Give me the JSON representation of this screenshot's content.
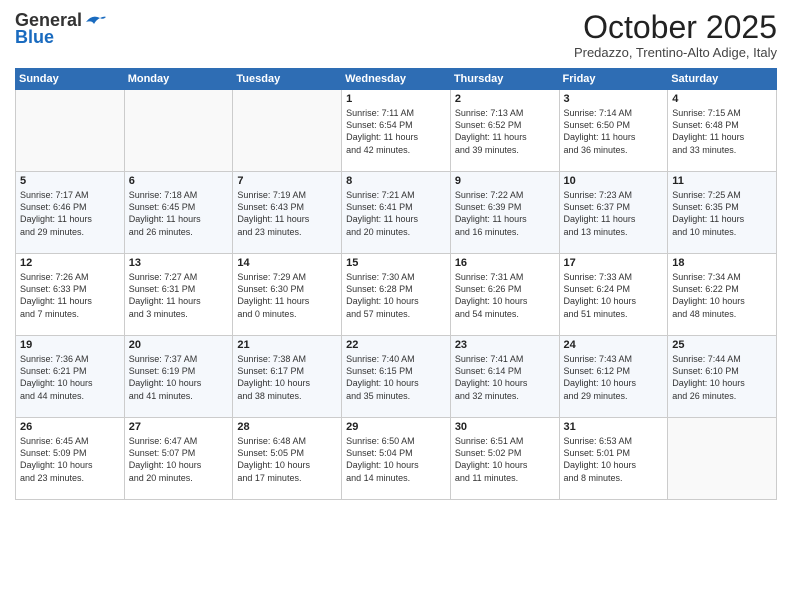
{
  "header": {
    "logo_general": "General",
    "logo_blue": "Blue",
    "month": "October 2025",
    "location": "Predazzo, Trentino-Alto Adige, Italy"
  },
  "days_of_week": [
    "Sunday",
    "Monday",
    "Tuesday",
    "Wednesday",
    "Thursday",
    "Friday",
    "Saturday"
  ],
  "weeks": [
    [
      {
        "day": "",
        "info": ""
      },
      {
        "day": "",
        "info": ""
      },
      {
        "day": "",
        "info": ""
      },
      {
        "day": "1",
        "info": "Sunrise: 7:11 AM\nSunset: 6:54 PM\nDaylight: 11 hours\nand 42 minutes."
      },
      {
        "day": "2",
        "info": "Sunrise: 7:13 AM\nSunset: 6:52 PM\nDaylight: 11 hours\nand 39 minutes."
      },
      {
        "day": "3",
        "info": "Sunrise: 7:14 AM\nSunset: 6:50 PM\nDaylight: 11 hours\nand 36 minutes."
      },
      {
        "day": "4",
        "info": "Sunrise: 7:15 AM\nSunset: 6:48 PM\nDaylight: 11 hours\nand 33 minutes."
      }
    ],
    [
      {
        "day": "5",
        "info": "Sunrise: 7:17 AM\nSunset: 6:46 PM\nDaylight: 11 hours\nand 29 minutes."
      },
      {
        "day": "6",
        "info": "Sunrise: 7:18 AM\nSunset: 6:45 PM\nDaylight: 11 hours\nand 26 minutes."
      },
      {
        "day": "7",
        "info": "Sunrise: 7:19 AM\nSunset: 6:43 PM\nDaylight: 11 hours\nand 23 minutes."
      },
      {
        "day": "8",
        "info": "Sunrise: 7:21 AM\nSunset: 6:41 PM\nDaylight: 11 hours\nand 20 minutes."
      },
      {
        "day": "9",
        "info": "Sunrise: 7:22 AM\nSunset: 6:39 PM\nDaylight: 11 hours\nand 16 minutes."
      },
      {
        "day": "10",
        "info": "Sunrise: 7:23 AM\nSunset: 6:37 PM\nDaylight: 11 hours\nand 13 minutes."
      },
      {
        "day": "11",
        "info": "Sunrise: 7:25 AM\nSunset: 6:35 PM\nDaylight: 11 hours\nand 10 minutes."
      }
    ],
    [
      {
        "day": "12",
        "info": "Sunrise: 7:26 AM\nSunset: 6:33 PM\nDaylight: 11 hours\nand 7 minutes."
      },
      {
        "day": "13",
        "info": "Sunrise: 7:27 AM\nSunset: 6:31 PM\nDaylight: 11 hours\nand 3 minutes."
      },
      {
        "day": "14",
        "info": "Sunrise: 7:29 AM\nSunset: 6:30 PM\nDaylight: 11 hours\nand 0 minutes."
      },
      {
        "day": "15",
        "info": "Sunrise: 7:30 AM\nSunset: 6:28 PM\nDaylight: 10 hours\nand 57 minutes."
      },
      {
        "day": "16",
        "info": "Sunrise: 7:31 AM\nSunset: 6:26 PM\nDaylight: 10 hours\nand 54 minutes."
      },
      {
        "day": "17",
        "info": "Sunrise: 7:33 AM\nSunset: 6:24 PM\nDaylight: 10 hours\nand 51 minutes."
      },
      {
        "day": "18",
        "info": "Sunrise: 7:34 AM\nSunset: 6:22 PM\nDaylight: 10 hours\nand 48 minutes."
      }
    ],
    [
      {
        "day": "19",
        "info": "Sunrise: 7:36 AM\nSunset: 6:21 PM\nDaylight: 10 hours\nand 44 minutes."
      },
      {
        "day": "20",
        "info": "Sunrise: 7:37 AM\nSunset: 6:19 PM\nDaylight: 10 hours\nand 41 minutes."
      },
      {
        "day": "21",
        "info": "Sunrise: 7:38 AM\nSunset: 6:17 PM\nDaylight: 10 hours\nand 38 minutes."
      },
      {
        "day": "22",
        "info": "Sunrise: 7:40 AM\nSunset: 6:15 PM\nDaylight: 10 hours\nand 35 minutes."
      },
      {
        "day": "23",
        "info": "Sunrise: 7:41 AM\nSunset: 6:14 PM\nDaylight: 10 hours\nand 32 minutes."
      },
      {
        "day": "24",
        "info": "Sunrise: 7:43 AM\nSunset: 6:12 PM\nDaylight: 10 hours\nand 29 minutes."
      },
      {
        "day": "25",
        "info": "Sunrise: 7:44 AM\nSunset: 6:10 PM\nDaylight: 10 hours\nand 26 minutes."
      }
    ],
    [
      {
        "day": "26",
        "info": "Sunrise: 6:45 AM\nSunset: 5:09 PM\nDaylight: 10 hours\nand 23 minutes."
      },
      {
        "day": "27",
        "info": "Sunrise: 6:47 AM\nSunset: 5:07 PM\nDaylight: 10 hours\nand 20 minutes."
      },
      {
        "day": "28",
        "info": "Sunrise: 6:48 AM\nSunset: 5:05 PM\nDaylight: 10 hours\nand 17 minutes."
      },
      {
        "day": "29",
        "info": "Sunrise: 6:50 AM\nSunset: 5:04 PM\nDaylight: 10 hours\nand 14 minutes."
      },
      {
        "day": "30",
        "info": "Sunrise: 6:51 AM\nSunset: 5:02 PM\nDaylight: 10 hours\nand 11 minutes."
      },
      {
        "day": "31",
        "info": "Sunrise: 6:53 AM\nSunset: 5:01 PM\nDaylight: 10 hours\nand 8 minutes."
      },
      {
        "day": "",
        "info": ""
      }
    ]
  ]
}
